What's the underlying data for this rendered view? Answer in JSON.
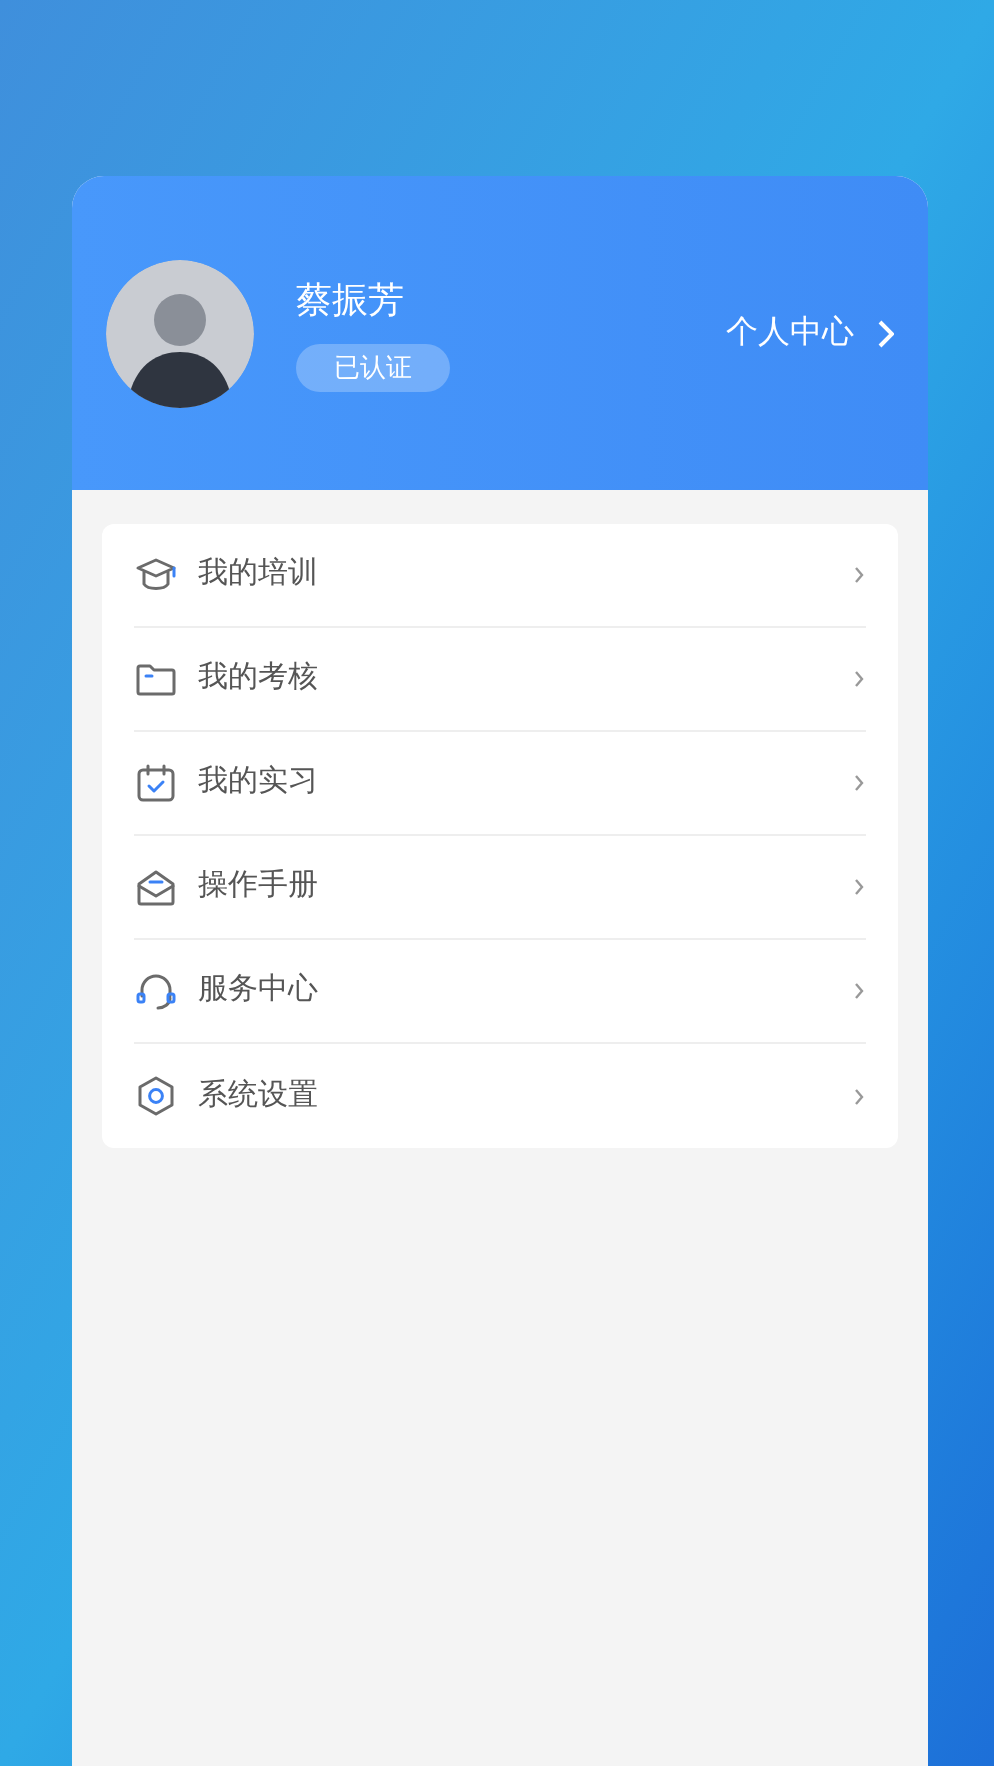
{
  "profile": {
    "name": "蔡振芳",
    "badge": "已认证",
    "link": "个人中心"
  },
  "menu": [
    {
      "kind": "training",
      "label": "我的培训"
    },
    {
      "kind": "exam",
      "label": "我的考核"
    },
    {
      "kind": "internship",
      "label": "我的实习"
    },
    {
      "kind": "manual",
      "label": "操作手册"
    },
    {
      "kind": "service",
      "label": "服务中心"
    },
    {
      "kind": "settings",
      "label": "系统设置"
    }
  ]
}
